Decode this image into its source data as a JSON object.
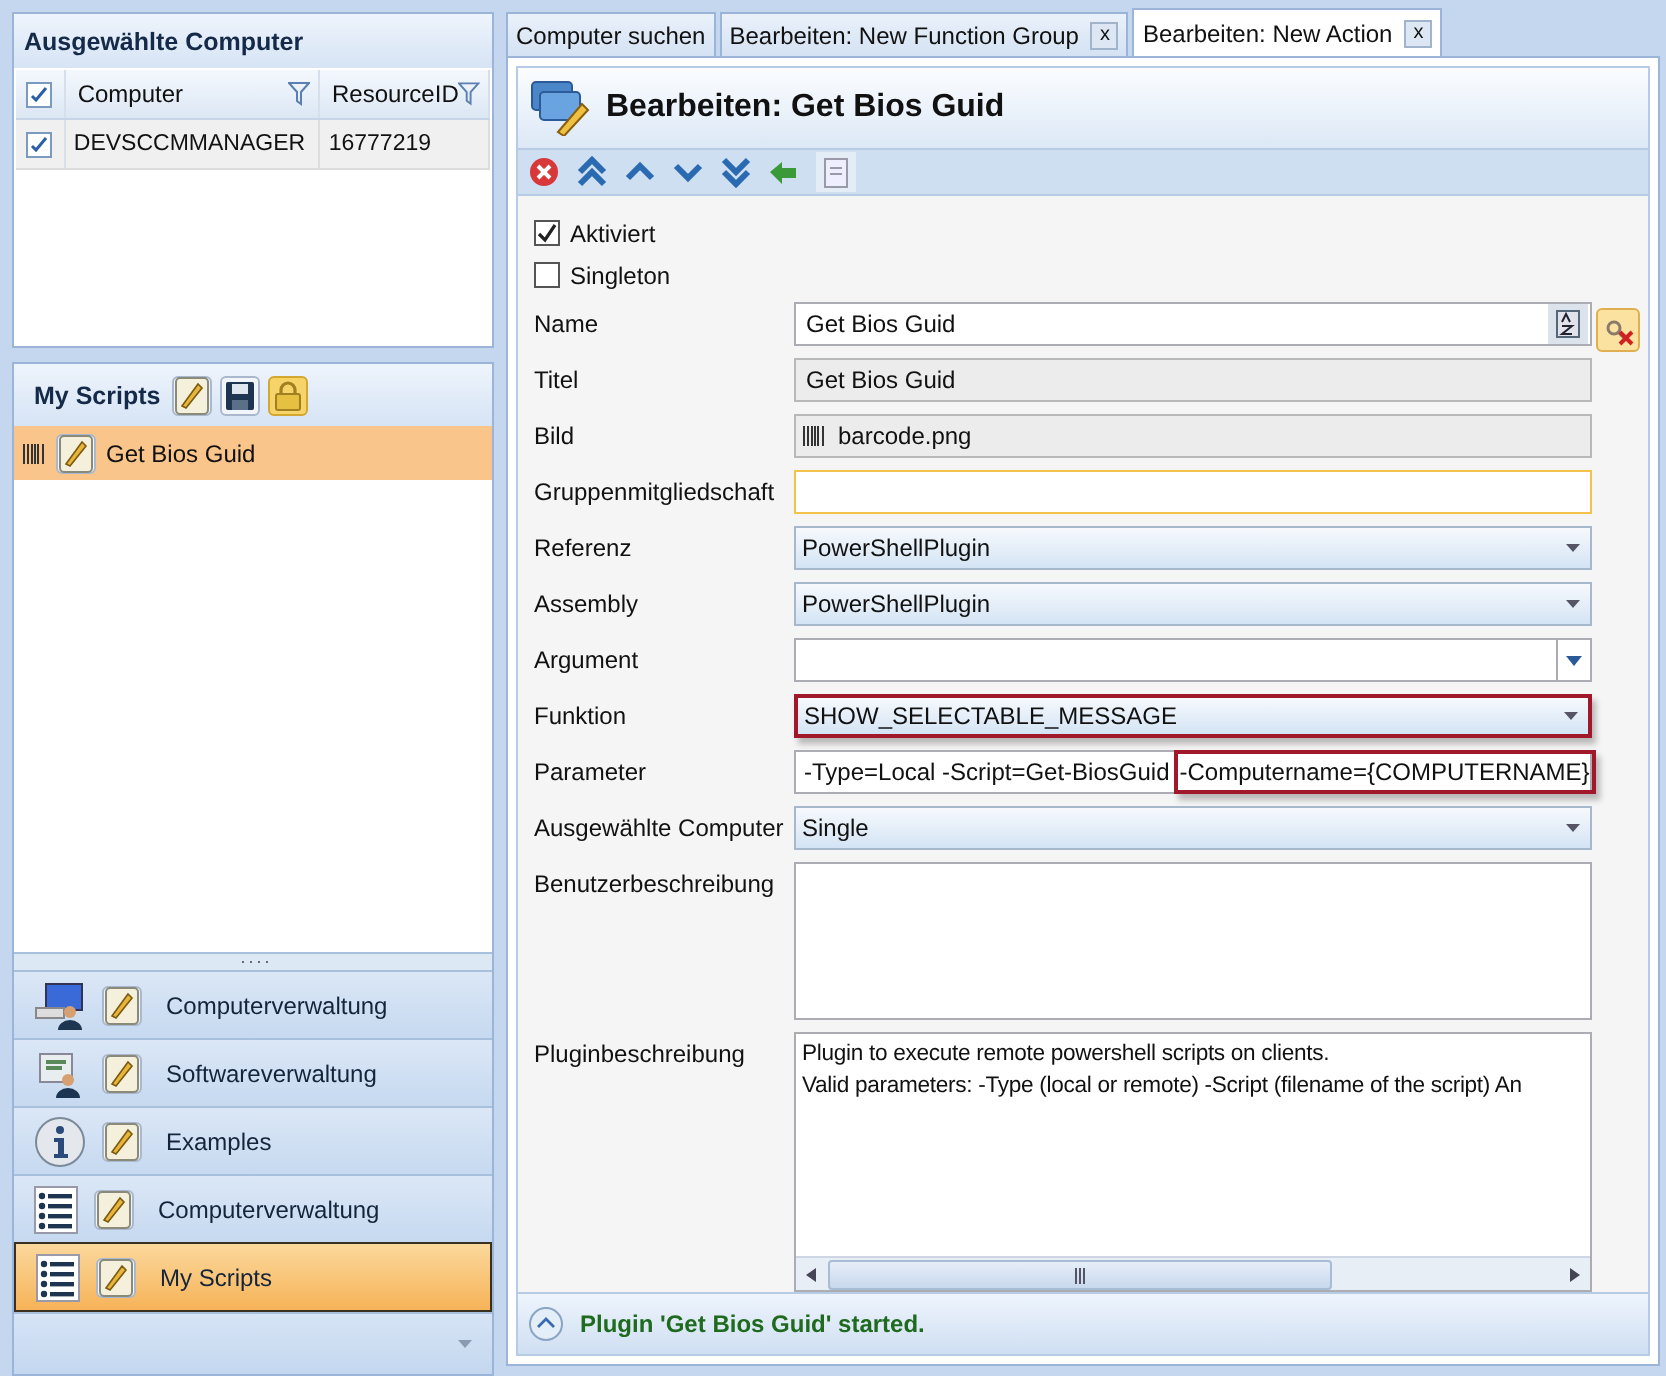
{
  "selected_computers": {
    "title": "Ausgewählte Computer",
    "header_checked": true,
    "columns": [
      "Computer",
      "ResourceID"
    ],
    "rows": [
      {
        "checked": true,
        "cells": [
          "DEVSCCMMANAGER",
          "16777219"
        ]
      }
    ]
  },
  "scripts_panel": {
    "title": "My Scripts",
    "items": [
      {
        "label": "Get Bios Guid",
        "selected": true
      }
    ]
  },
  "nav": [
    {
      "label": "Computerverwaltung",
      "kind": "computer",
      "selected": false
    },
    {
      "label": "Softwareverwaltung",
      "kind": "software",
      "selected": false
    },
    {
      "label": "Examples",
      "kind": "info",
      "selected": false
    },
    {
      "label": "Computerverwaltung",
      "kind": "list",
      "selected": false
    },
    {
      "label": "My Scripts",
      "kind": "list",
      "selected": true
    }
  ],
  "tabs": [
    {
      "label": "Computer suchen",
      "selected": false
    },
    {
      "label": "Bearbeiten: New Function Group",
      "selected": false,
      "close": "x"
    },
    {
      "label": "Bearbeiten: New Action",
      "selected": true,
      "close": "x"
    }
  ],
  "editor": {
    "title": "Bearbeiten: Get Bios Guid",
    "checkboxes": [
      {
        "label": "Aktiviert",
        "checked": true
      },
      {
        "label": "Singleton",
        "checked": false
      }
    ],
    "fields": [
      {
        "label": "Name",
        "kind": "text",
        "value": "Get Bios Guid",
        "focused": false
      },
      {
        "label": "Titel",
        "kind": "readonly",
        "value": "Get Bios Guid"
      },
      {
        "label": "Bild",
        "kind": "image",
        "value": "barcode.png"
      },
      {
        "label": "Gruppenmitgliedschaft",
        "kind": "text",
        "focused": true
      },
      {
        "label": "Referenz",
        "kind": "dropdown",
        "value": "PowerShellPlugin",
        "highlighted": false
      },
      {
        "label": "Assembly",
        "kind": "dropdown",
        "value": "PowerShellPlugin",
        "highlighted": false
      },
      {
        "label": "Argument",
        "kind": "combo"
      },
      {
        "label": "Funktion",
        "kind": "dropdown",
        "value": "SHOW_SELECTABLE_MESSAGE",
        "highlighted": true
      },
      {
        "label": "Parameter",
        "kind": "parts",
        "parts": [
          {
            "text": "-Type=Local -Script=Get-BiosGuid",
            "highlighted": false
          },
          {
            "text": "-Computername={COMPUTERNAME}",
            "highlighted": true
          }
        ]
      },
      {
        "label": "Ausgewählte Computer",
        "kind": "dropdown",
        "value": "Single",
        "highlighted": false
      },
      {
        "label": "Benutzerbeschreibung",
        "kind": "textarea"
      },
      {
        "label": "Pluginbeschreibung",
        "kind": "scrolltext",
        "lines": [
          "Plugin to execute remote powershell scripts on clients.",
          "Valid parameters: -Type (local or remote) -Script (filename of the script) An"
        ]
      }
    ],
    "status": "Plugin 'Get Bios Guid' started."
  }
}
